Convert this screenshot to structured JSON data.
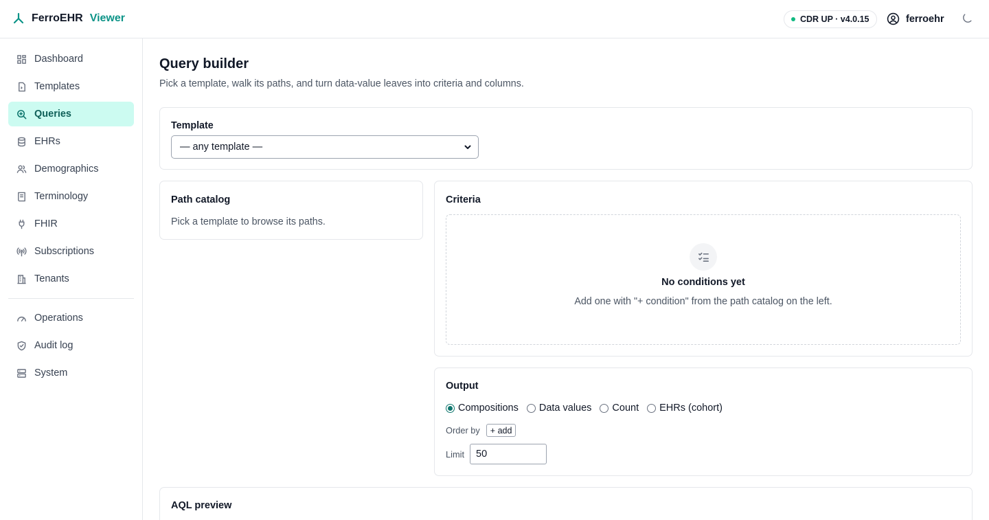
{
  "brand": {
    "name": "FerroEHR",
    "suffix": "Viewer"
  },
  "header": {
    "status": "CDR UP · v4.0.15",
    "user": "ferroehr",
    "theme_icon": "moon-icon"
  },
  "sidebar": {
    "items": [
      {
        "label": "Dashboard",
        "icon": "dashboard-icon"
      },
      {
        "label": "Templates",
        "icon": "template-icon"
      },
      {
        "label": "Queries",
        "icon": "query-icon",
        "active": true
      },
      {
        "label": "EHRs",
        "icon": "database-icon"
      },
      {
        "label": "Demographics",
        "icon": "users-icon"
      },
      {
        "label": "Terminology",
        "icon": "book-icon"
      },
      {
        "label": "FHIR",
        "icon": "plug-icon"
      },
      {
        "label": "Subscriptions",
        "icon": "broadcast-icon"
      },
      {
        "label": "Tenants",
        "icon": "building-icon"
      }
    ],
    "secondary": [
      {
        "label": "Operations",
        "icon": "gauge-icon"
      },
      {
        "label": "Audit log",
        "icon": "shield-icon"
      },
      {
        "label": "System",
        "icon": "server-icon"
      }
    ]
  },
  "page": {
    "title": "Query builder",
    "subtitle": "Pick a template, walk its paths, and turn data-value leaves into criteria and columns."
  },
  "template": {
    "label": "Template",
    "selected": "— any template —"
  },
  "path_catalog": {
    "title": "Path catalog",
    "help": "Pick a template to browse its paths."
  },
  "criteria": {
    "title": "Criteria",
    "empty_title": "No conditions yet",
    "empty_text": "Add one with \"+ condition\" from the path catalog on the left."
  },
  "output": {
    "title": "Output",
    "options": [
      {
        "label": "Compositions",
        "checked": true
      },
      {
        "label": "Data values",
        "checked": false
      },
      {
        "label": "Count",
        "checked": false
      },
      {
        "label": "EHRs (cohort)",
        "checked": false
      }
    ],
    "order_by_label": "Order by",
    "add_label": "+ add",
    "limit_label": "Limit",
    "limit_value": "50"
  },
  "preview": {
    "title": "AQL preview"
  },
  "colors": {
    "accent": "#0d9488",
    "active_bg": "#ccfbf1",
    "status": "#10b981"
  }
}
